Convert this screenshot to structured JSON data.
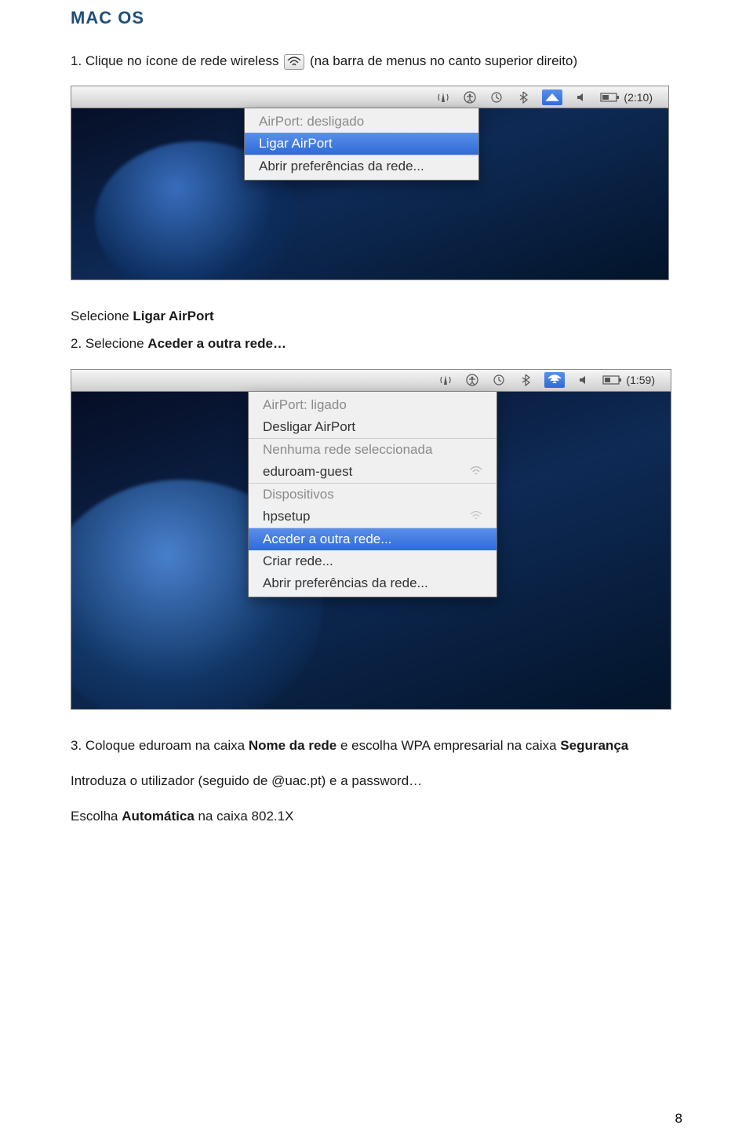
{
  "heading": "MAC OS",
  "step1": {
    "pre": "1. Clique no ícone de rede wireless",
    "post": "(na barra de menus no canto superior direito)"
  },
  "screenshot1": {
    "time": "(2:10)",
    "menu": {
      "status": "AirPort: desligado",
      "ligar": "Ligar AirPort",
      "prefs": "Abrir preferências da rede..."
    }
  },
  "mid1_pre": "Selecione ",
  "mid1_bold": "Ligar AirPort",
  "step2_pre": "2. Selecione ",
  "step2_bold": "Aceder a outra rede…",
  "screenshot2": {
    "time": "(1:59)",
    "menu": {
      "status": "AirPort: ligado",
      "desligar": "Desligar AirPort",
      "nosel": "Nenhuma rede seleccionada",
      "net1": "eduroam-guest",
      "devhead": "Dispositivos",
      "dev1": "hpsetup",
      "aceder": "Aceder a outra rede...",
      "criar": "Criar rede...",
      "prefs": "Abrir preferências da rede..."
    }
  },
  "step3": {
    "line1_a": "3. Coloque eduroam na caixa ",
    "line1_b": "Nome da rede",
    "line1_c": " e escolha WPA empresarial na caixa ",
    "line1_d": "Segurança",
    "line2": "Introduza o utilizador (seguido de @uac.pt) e a password…",
    "line3_a": "Escolha ",
    "line3_b": "Automática",
    "line3_c": " na caixa 802.1X"
  },
  "page_number": "8"
}
